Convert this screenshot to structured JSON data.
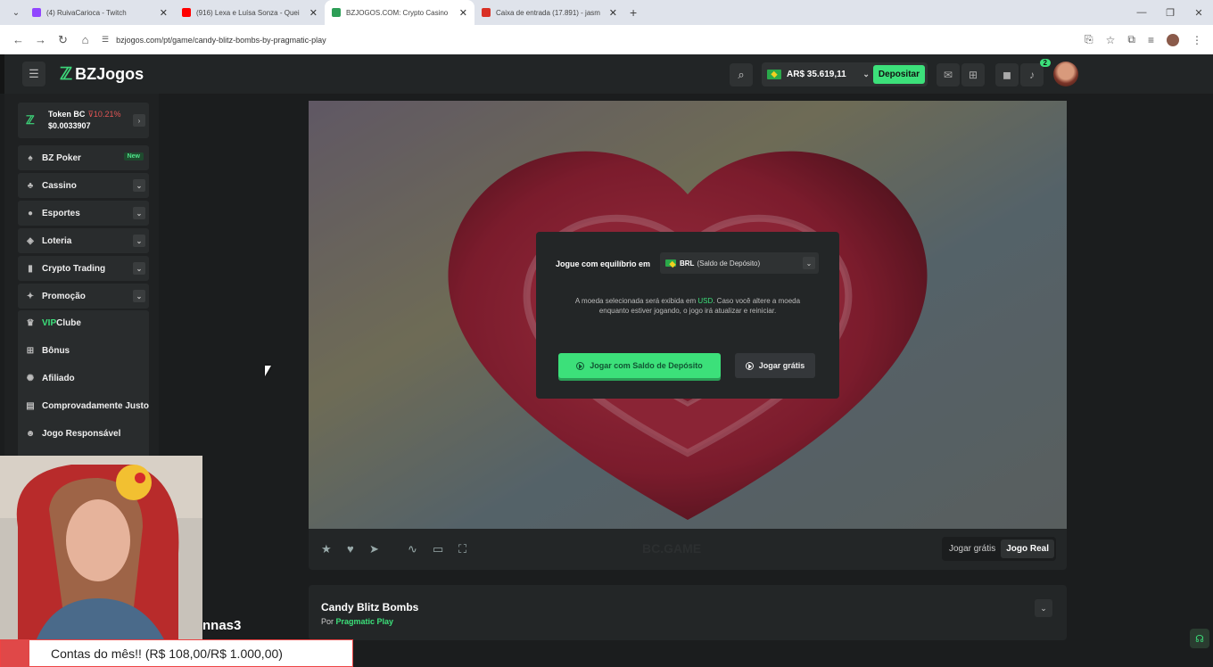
{
  "browser": {
    "tabs": [
      {
        "title": "(4) RuivaCarioca - Twitch",
        "color": "#9146ff"
      },
      {
        "title": "(916) Lexa e Luísa Sonza - Quei",
        "color": "#ff0000"
      },
      {
        "title": "BZJOGOS.COM: Crypto Casino",
        "color": "#2e9e57"
      },
      {
        "title": "Caixa de entrada (17.891) - jasm",
        "color": "#d93025"
      }
    ],
    "url": "bzjogos.com/pt/game/candy-blitz-bombs-by-pragmatic-play"
  },
  "header": {
    "logo_text": "BZJogos",
    "balance": "AR$ 35.619,11",
    "deposit_label": "Depositar",
    "notif_count": "2"
  },
  "sidebar": {
    "token_name": "Token BC",
    "token_change": "⊽10.21%",
    "token_value": "$0.0033907",
    "items": [
      {
        "label": "BZ Poker",
        "icon": "poker-icon",
        "tag": "New"
      },
      {
        "label": "Cassino",
        "icon": "casino-icon"
      },
      {
        "label": "Esportes",
        "icon": "sports-icon"
      },
      {
        "label": "Loteria",
        "icon": "lottery-icon"
      },
      {
        "label": "Crypto Trading",
        "icon": "chart-icon"
      },
      {
        "label": "Promoção",
        "icon": "promo-icon"
      }
    ],
    "group": [
      {
        "label_a": "VIP",
        "label_b": " Clube",
        "icon": "vip-icon"
      },
      {
        "label": "Bônus",
        "icon": "gift-icon"
      },
      {
        "label": "Afiliado",
        "icon": "affiliate-icon"
      },
      {
        "label": "Comprovadamente Justo",
        "icon": "fair-icon"
      },
      {
        "label": "Jogo Responsável",
        "icon": "responsible-icon"
      }
    ]
  },
  "modal": {
    "title": "Jogue com equilíbrio em",
    "currency": "BRL",
    "currency_note": "(Saldo de Depósito)",
    "note_a": "A moeda selecionada será exibida em ",
    "note_usd": "USD",
    "note_b": ". Caso você altere a moeda enquanto estiver jogando, o jogo irá atualizar e reiniciar.",
    "play_deposit": "Jogar com Saldo de Depósito",
    "play_free": "Jogar grátis"
  },
  "gamebar": {
    "watermark": "BC.GAME",
    "toggle_free": "Jogar grátis",
    "toggle_real": "Jogo Real"
  },
  "game_info": {
    "title": "Candy Blitz Bombs",
    "by": "Por ",
    "provider": "Pragmatic Play"
  },
  "stream": {
    "name_fragment": "nnas3",
    "goal_text": "Contas do mês!! (R$ 108,00/R$ 1.000,00)"
  }
}
